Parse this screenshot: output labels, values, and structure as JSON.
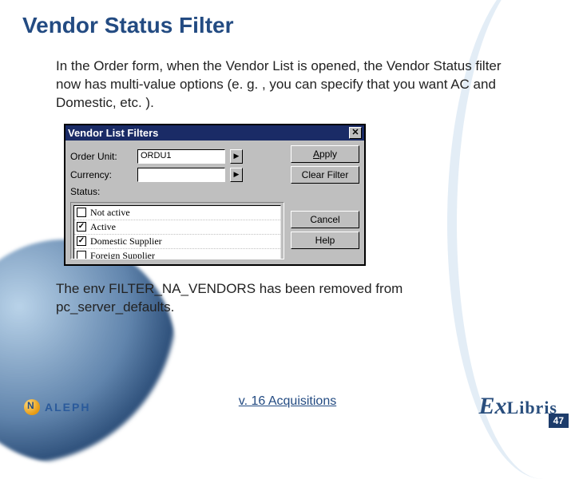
{
  "title": "Vendor Status Filter",
  "paragraph1": "In the Order form, when the Vendor List is opened, the Vendor Status filter now has multi-value options (e. g. , you can specify that you want AC and Domestic, etc. ).",
  "paragraph2": "The env FILTER_NA_VENDORS has been removed from pc_server_defaults.",
  "dialog": {
    "title": "Vendor List Filters",
    "close": "✕",
    "buttons": {
      "apply": "Apply",
      "clear": "Clear Filter",
      "cancel": "Cancel",
      "help": "Help"
    },
    "fields": {
      "order_unit_label": "Order Unit:",
      "order_unit_value": "ORDU1",
      "currency_label": "Currency:",
      "currency_value": "",
      "status_label": "Status:"
    },
    "status_items": [
      {
        "label": "Not active",
        "checked": false
      },
      {
        "label": "Active",
        "checked": true
      },
      {
        "label": "Domestic Supplier",
        "checked": true
      },
      {
        "label": "Foreign Supplier",
        "checked": false
      }
    ],
    "arrow_glyph": "▶"
  },
  "footer": {
    "subject": "v. 16 Acquisitions",
    "left_logo": "ALEPH",
    "right_logo_ex": "Ex",
    "right_logo_libris": "Libris",
    "page_number": "47"
  }
}
